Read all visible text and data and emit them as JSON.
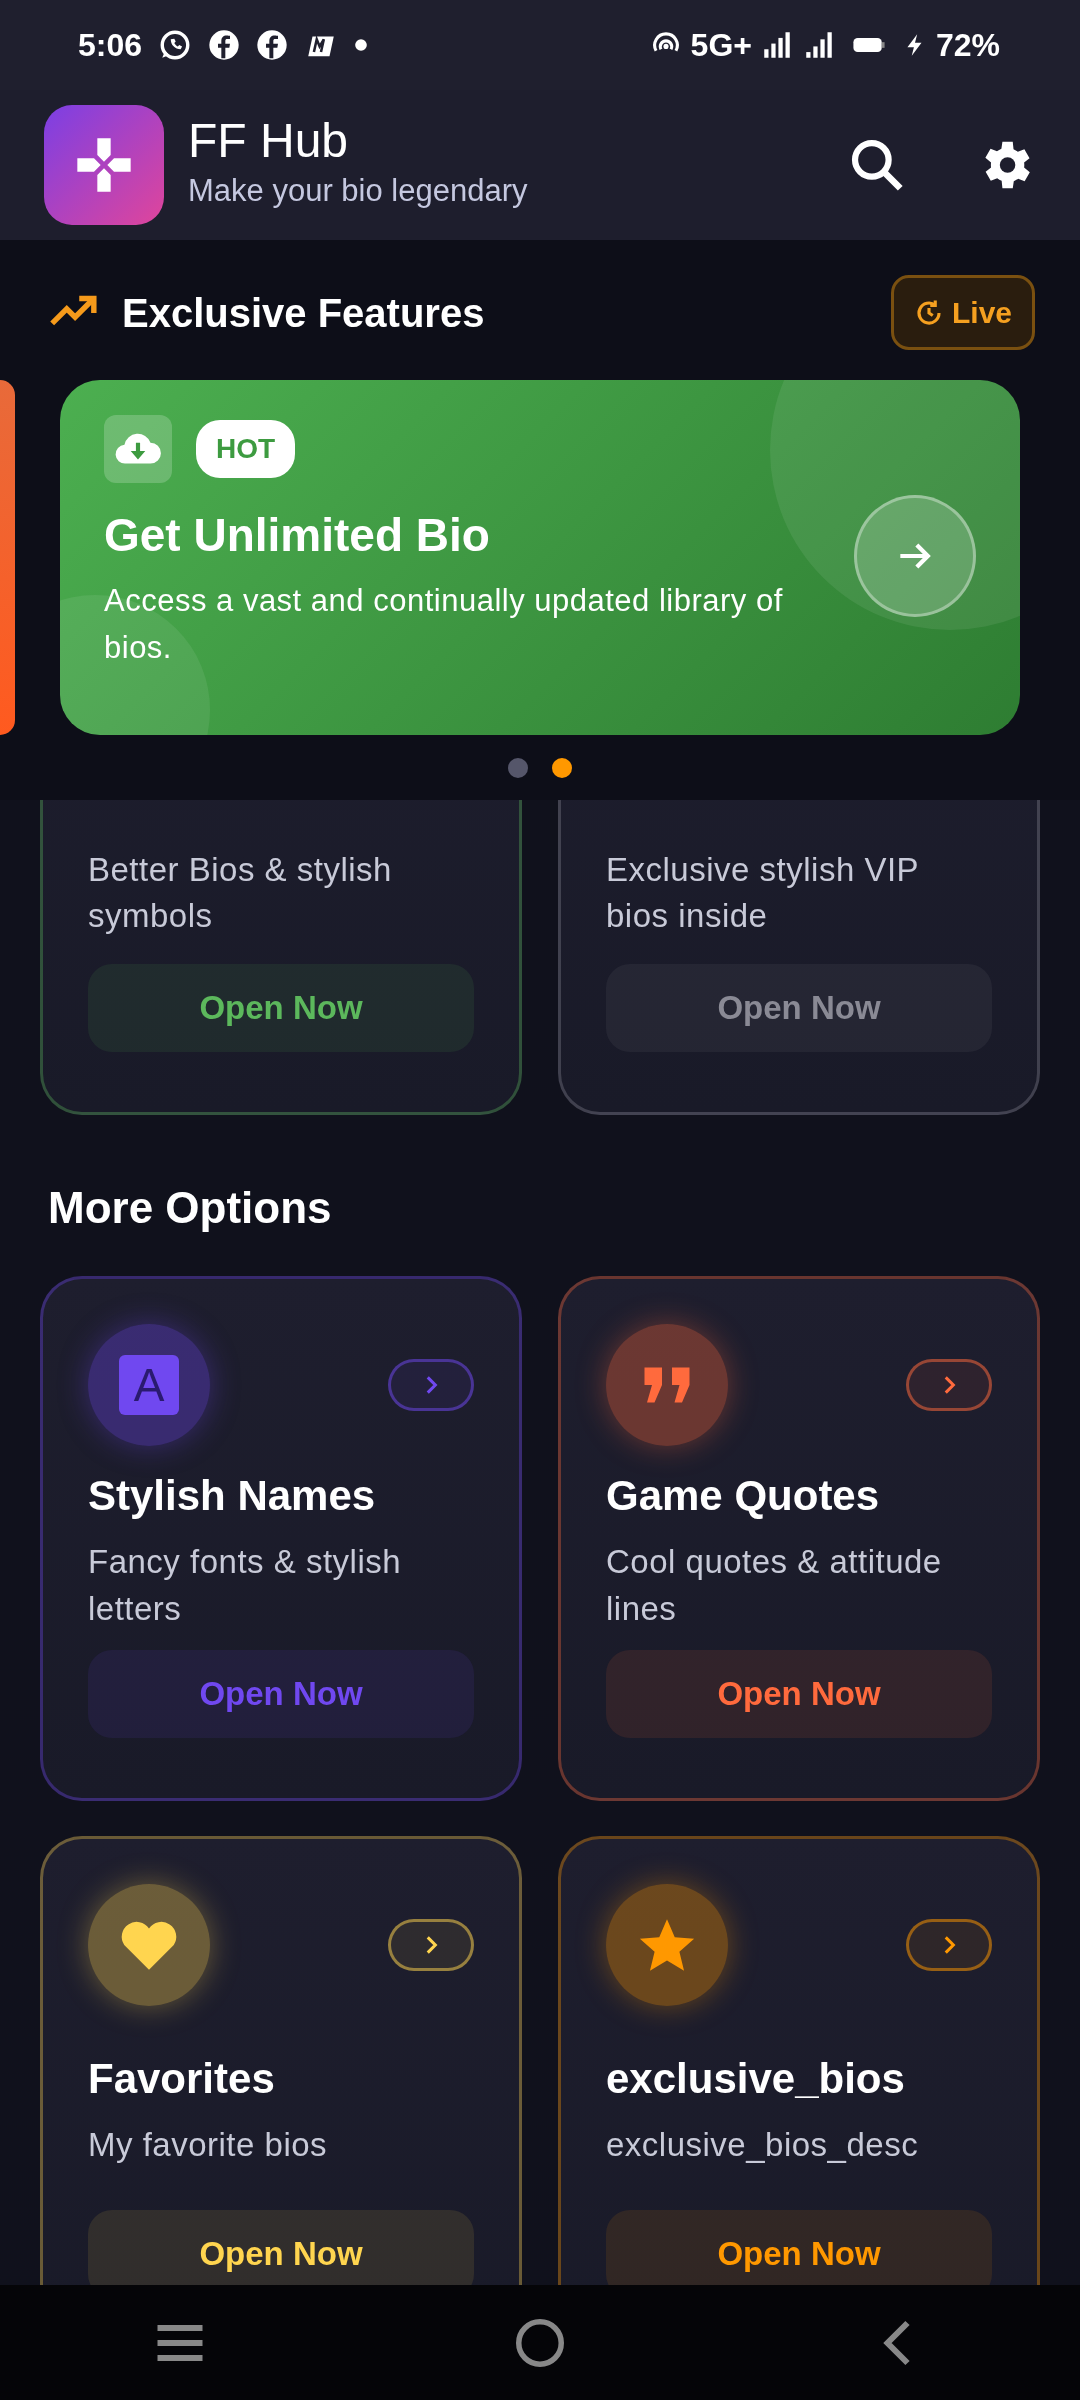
{
  "status_bar": {
    "time": "5:06",
    "network": "5G+",
    "battery": "72%"
  },
  "header": {
    "title": "FF Hub",
    "subtitle": "Make your bio legendary"
  },
  "exclusive": {
    "title": "Exclusive Features",
    "live_label": "Live",
    "banner": {
      "badge": "HOT",
      "title": "Get Unlimited Bio",
      "description": "Access a vast and continually updated library of bios."
    },
    "dots": [
      {
        "selected": false
      },
      {
        "selected": true
      }
    ]
  },
  "top_cards": [
    {
      "description": "Better Bios & stylish symbols",
      "button": "Open Now",
      "color": "#5cb85c"
    },
    {
      "description": "Exclusive stylish VIP bios inside",
      "button": "Open Now",
      "color": "#8a8a95"
    }
  ],
  "more_options": {
    "title": "More Options",
    "cards": [
      {
        "kind": "letter",
        "icon_text": "A",
        "title": "Stylish Names",
        "description": "Fancy fonts & stylish letters",
        "button": "Open Now",
        "color": "#7048f0"
      },
      {
        "kind": "quote",
        "title": "Game Quotes",
        "description": "Cool quotes & attitude lines",
        "button": "Open Now",
        "color": "#ff6a3d"
      },
      {
        "kind": "heart",
        "title": "Favorites",
        "description": "My favorite bios",
        "button": "Open Now",
        "color": "#ffd54f"
      },
      {
        "kind": "star",
        "title": "exclusive_bios",
        "description": "exclusive_bios_desc",
        "button": "Open Now",
        "color": "#ff9800"
      }
    ]
  }
}
